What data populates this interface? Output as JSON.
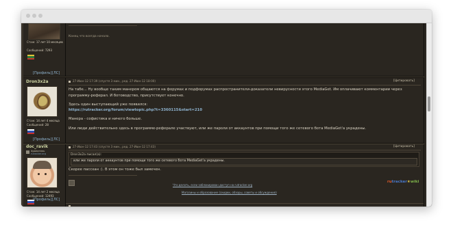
{
  "window": {
    "title": ""
  },
  "post1": {
    "member_label": "Стаж:",
    "member_value": "17 лет 10 месяцев",
    "posts_label": "Сообщений:",
    "posts_value": "7293",
    "profile_link": "[Профиль]",
    "pm_link": "[ЛС]",
    "text": "Конец что всегда начало."
  },
  "post2": {
    "nick": "Dron3x2a",
    "header": "27-Июн-12 17:39  (спустя 3 мин., ред. 27-Июн-12 18:00)",
    "quote_button": "[Цитировать]",
    "line1": "На табе... Ну вообще таким манером общаются на форумах и подфорумах распространители-доказатели невирусности этого MediaGet. Им оплачивают комментарии через",
    "line2": "программу-реферал. И ботоводство, присутствует конечно.",
    "line3": "Здесь один выступающий уже появился:",
    "link": "https://rutracker.org/forum/viewtopic.php?t=3360115&start=210",
    "line4": "Манера - софистика и ничего больше.",
    "line5": "Или люди действительно здесь в программе-реферале участвуют, или же пароли от аккаунтов при помощи того же сетевого бота MediaGet'a украдены.",
    "member_label": "Стаж:",
    "member_value": "14 лет 4 месяца",
    "posts_label": "Сообщений:",
    "posts_value": "28",
    "profile_link": "[Профиль]",
    "pm_link": "[ЛС]"
  },
  "post3": {
    "nick": "doc_ravik",
    "badge_line1": "Хранитель",
    "badge_line2": "rutracker.org",
    "header": "27-Июн-12 17:43  (спустя 3 мин., ред. 27-Июн-12 17:43)",
    "quote_button": "[Цитировать]",
    "quote_author": "Dron3x2a писал(а):",
    "quote_text": "или же пароли от аккаунтов при помощи того же сетевого бота MediaGet'a украдены.",
    "reply": "Скорее пассхан :). В этом он тоже был замечен.",
    "footer_link1": "Что делать, если заблокирован доступ на rutracker.org",
    "footer_link2": "Магазины и образование (скидки, обзоры, советы и обсуждения)",
    "brand_ru": "ru",
    "brand_tracker": "tracker",
    "brand_wiki": "wiki",
    "member_label": "Стаж:",
    "member_value": "14 лет 2 месяца",
    "posts_label": "Сообщений:",
    "posts_value": "12493",
    "profile_link": "[Профиль]",
    "pm_link": "[ЛС]"
  },
  "colors": {
    "page_bg": "#2a2620",
    "nick": "#cfd6a4",
    "link": "#8eb3cf",
    "text": "#ddd6c6",
    "brand_ru": "#e05a2a",
    "brand_tracker": "#4a78c8",
    "brand_wiki": "#7db24a"
  }
}
